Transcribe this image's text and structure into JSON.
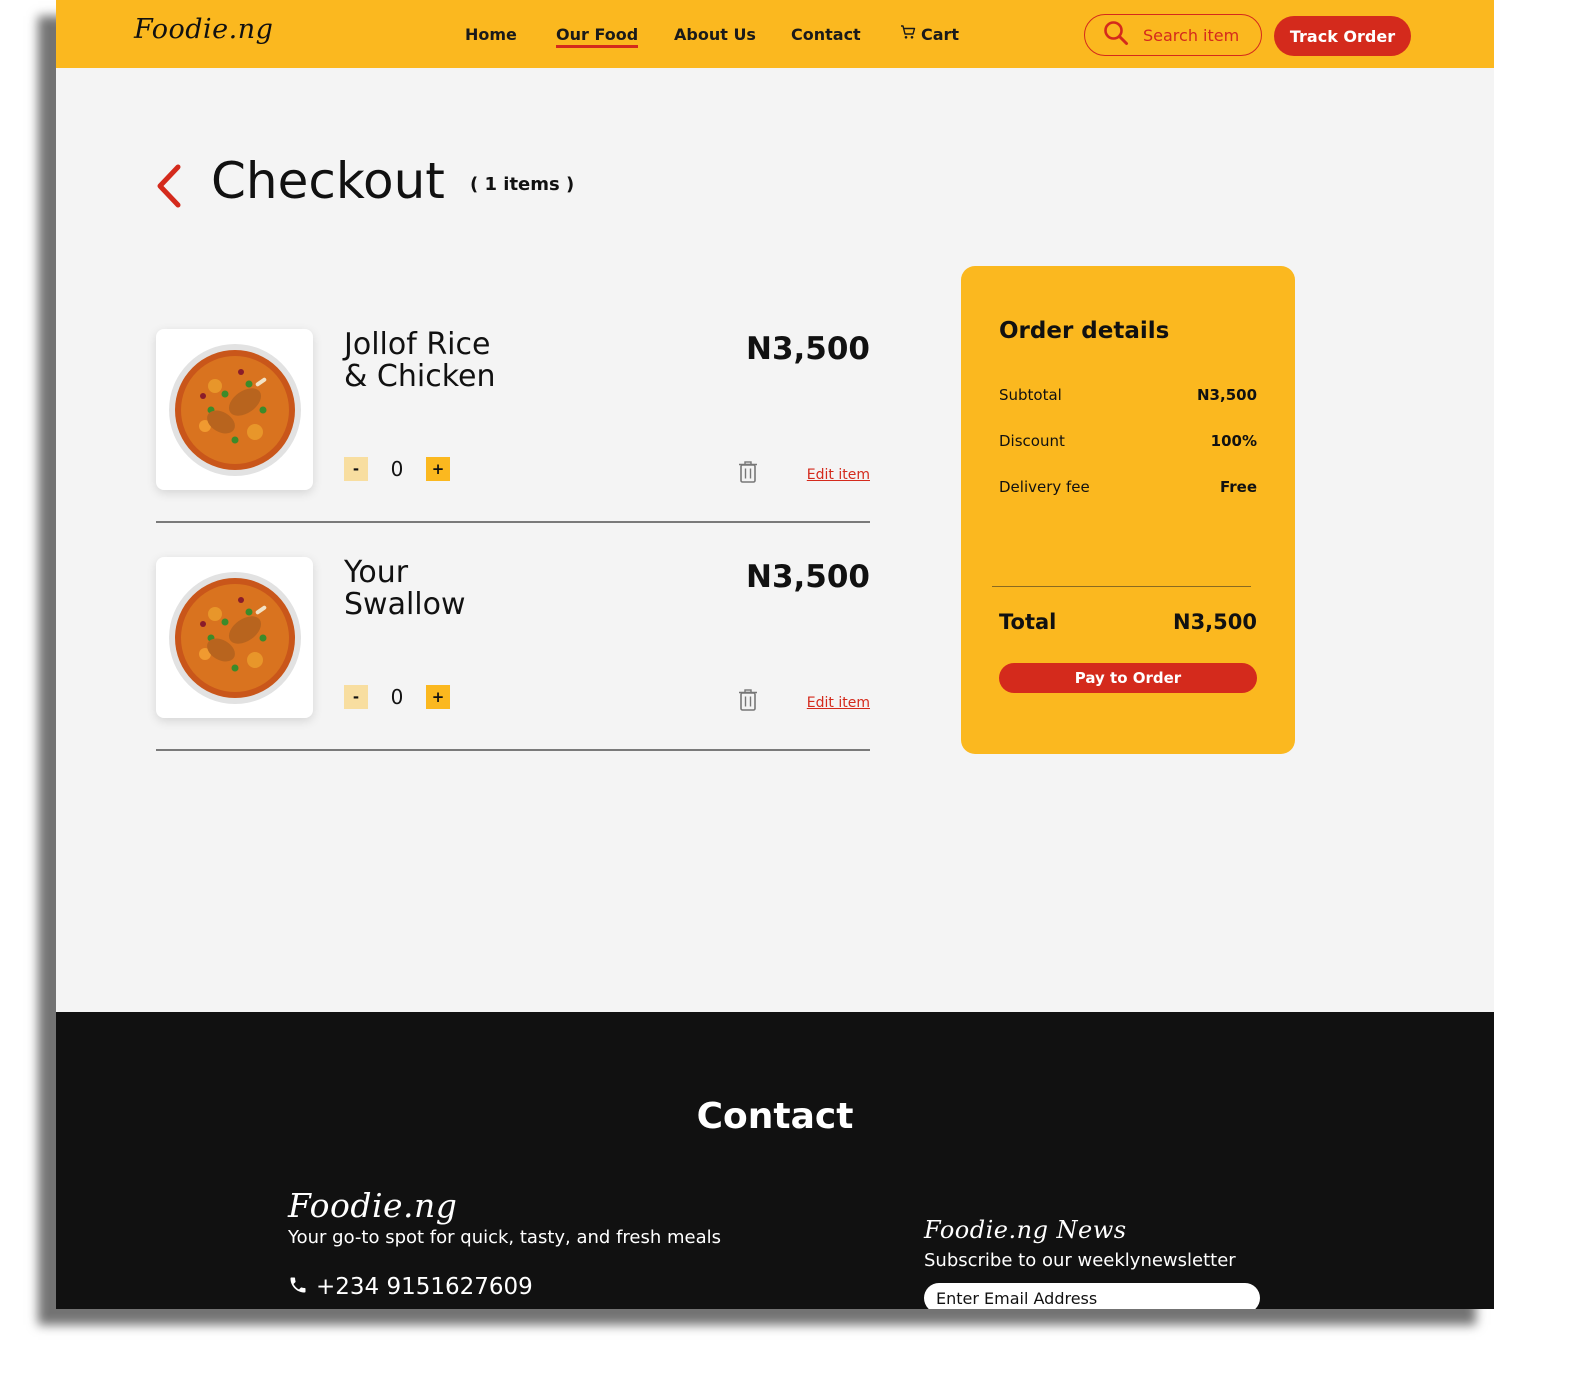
{
  "header": {
    "logo": "Foodie.ng",
    "nav": [
      {
        "label": "Home"
      },
      {
        "label": "Our Food",
        "active": true
      },
      {
        "label": "About Us"
      },
      {
        "label": "Contact"
      },
      {
        "label": "Cart",
        "icon": "cart-icon"
      }
    ],
    "search_placeholder": "Search item",
    "track_order_label": "Track Order"
  },
  "checkout": {
    "title": "Checkout",
    "item_count": "( 1 items )",
    "items": [
      {
        "name_line1": "Jollof Rice",
        "name_line2": "& Chicken",
        "price": "N3,500",
        "quantity": "0",
        "minus_label": "-",
        "plus_label": "+",
        "edit_label": "Edit item"
      },
      {
        "name_line1": "Your",
        "name_line2": "Swallow",
        "price": "N3,500",
        "quantity": "0",
        "minus_label": "-",
        "plus_label": "+",
        "edit_label": "Edit item"
      }
    ]
  },
  "order_details": {
    "title": "Order details",
    "rows": [
      {
        "label": "Subtotal",
        "value": "N3,500"
      },
      {
        "label": "Discount",
        "value": "100%"
      },
      {
        "label": "Delivery fee",
        "value": "Free"
      }
    ],
    "total_label": "Total",
    "total_value": "N3,500",
    "pay_label": "Pay to Order"
  },
  "footer": {
    "heading": "Contact",
    "logo": "Foodie.ng",
    "tagline": "Your go-to spot for quick, tasty, and fresh meals",
    "phone": "+234 9151627609",
    "news_title": "Foodie.ng News",
    "news_subtitle": "Subscribe to our weeklynewsletter",
    "email_placeholder": "Enter Email Address"
  },
  "colors": {
    "brand_yellow": "#fbb81f",
    "accent_red": "#d42a1c",
    "footer_bg": "#111111",
    "page_bg": "#f4f4f4"
  }
}
